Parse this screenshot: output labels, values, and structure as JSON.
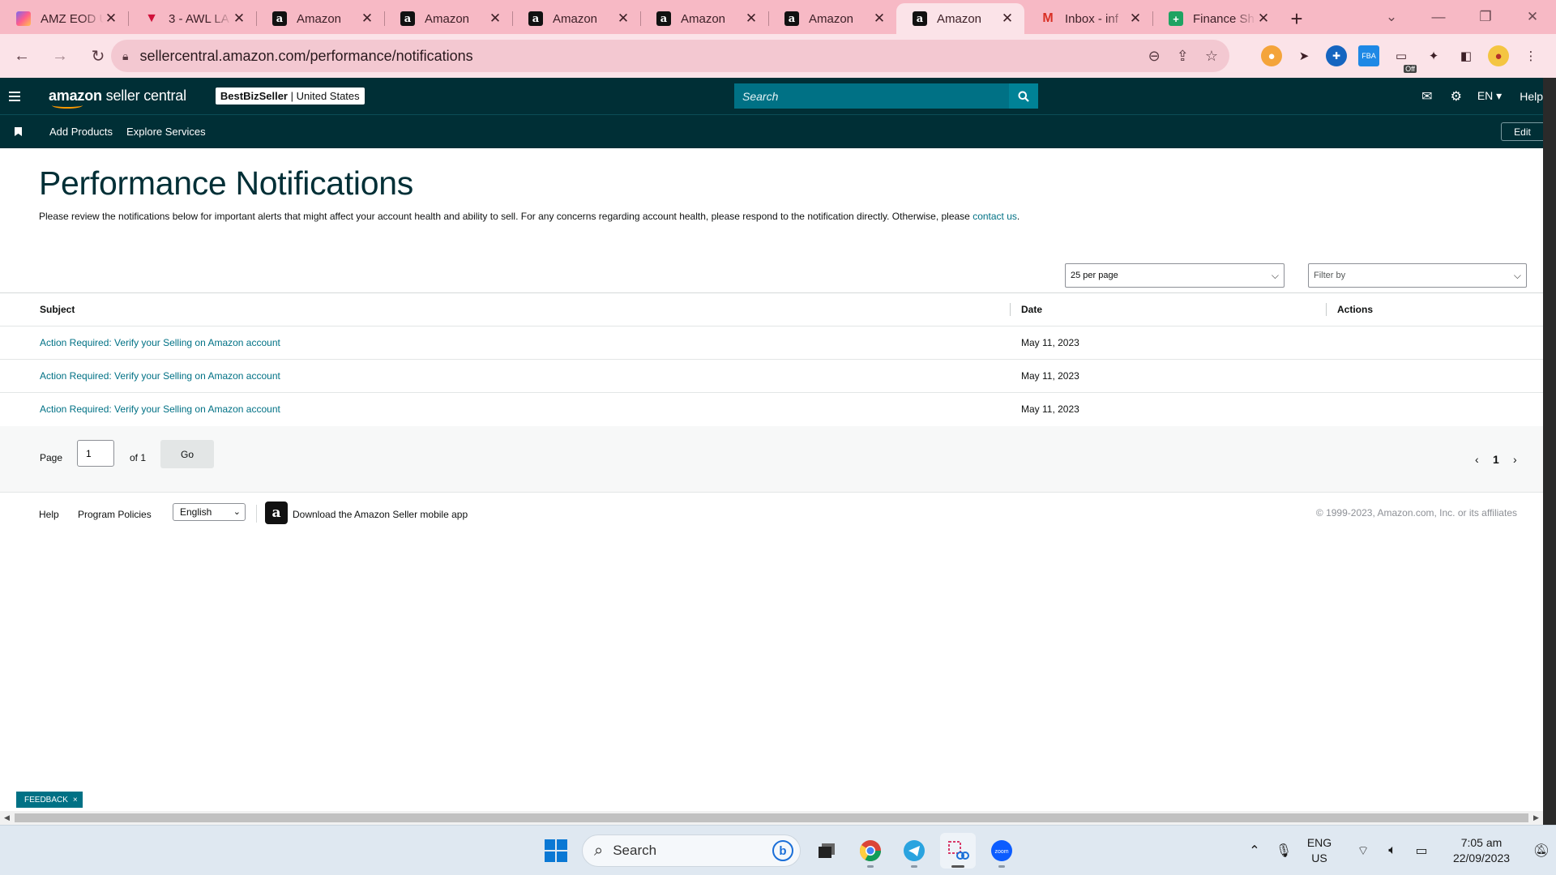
{
  "browser": {
    "tabs": [
      {
        "title": "AMZ EOD U",
        "icon": "clickup-icon",
        "active": false
      },
      {
        "title": "3 - AWL LA",
        "icon": "vivaldi-icon",
        "active": false
      },
      {
        "title": "Amazon",
        "icon": "amazon-icon",
        "active": false
      },
      {
        "title": "Amazon",
        "icon": "amazon-icon",
        "active": false
      },
      {
        "title": "Amazon",
        "icon": "amazon-icon",
        "active": false
      },
      {
        "title": "Amazon",
        "icon": "amazon-icon",
        "active": false
      },
      {
        "title": "Amazon",
        "icon": "amazon-icon",
        "active": false
      },
      {
        "title": "Amazon",
        "icon": "amazon-icon",
        "active": true
      },
      {
        "title": "Inbox - inf",
        "icon": "gmail-icon",
        "active": false
      },
      {
        "title": "Finance Sh",
        "icon": "sheets-icon",
        "active": false
      }
    ],
    "url": "sellercentral.amazon.com/performance/notifications",
    "extension_badge": "Off"
  },
  "header": {
    "logo_brand": "amazon",
    "logo_product": "seller central",
    "account_name": "BestBizSeller",
    "account_region": "United States",
    "search_placeholder": "Search",
    "language": "EN",
    "help": "Help"
  },
  "subnav": {
    "items": [
      "Add Products",
      "Explore Services"
    ],
    "edit": "Edit"
  },
  "page": {
    "title": "Performance Notifications",
    "intro": "Please review the notifications below for important alerts that might affect your account health and ability to sell. For any concerns regarding account health, please respond to the notification directly. Otherwise, please ",
    "contact_link": "contact us",
    "intro_end": ".",
    "per_page": "25 per page",
    "filter_placeholder": "Filter by"
  },
  "table": {
    "headers": {
      "subject": "Subject",
      "date": "Date",
      "actions": "Actions"
    },
    "rows": [
      {
        "subject": "Action Required: Verify your Selling on Amazon account",
        "date": "May 11, 2023"
      },
      {
        "subject": "Action Required: Verify your Selling on Amazon account",
        "date": "May 11, 2023"
      },
      {
        "subject": "Action Required: Verify your Selling on Amazon account",
        "date": "May 11, 2023"
      }
    ]
  },
  "pagination": {
    "page_label": "Page",
    "current_page": "1",
    "of_label": "of 1",
    "go_label": "Go",
    "page_number": "1"
  },
  "footer": {
    "help": "Help",
    "policies": "Program Policies",
    "language": "English",
    "app_text": "Download the Amazon Seller mobile app",
    "copyright": "© 1999-2023, Amazon.com, Inc. or its affiliates"
  },
  "feedback": {
    "label": "FEEDBACK",
    "close": "×"
  },
  "taskbar": {
    "search_label": "Search",
    "language_line1": "ENG",
    "language_line2": "US",
    "time": "7:05 am",
    "date": "22/09/2023"
  },
  "colors": {
    "header_bg": "#002f36",
    "link": "#007185",
    "tabstrip": "#f7b9c5"
  }
}
